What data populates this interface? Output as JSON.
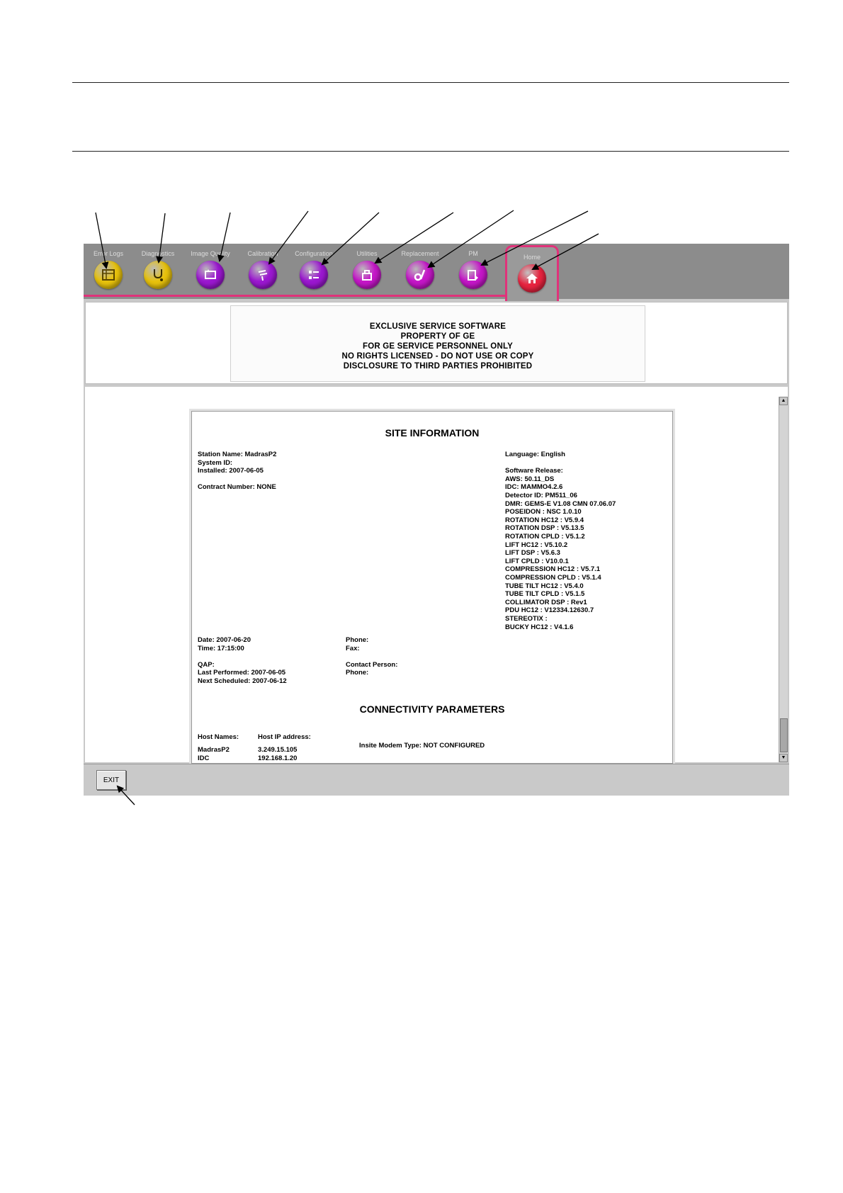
{
  "tabs": [
    {
      "label": "Error Logs",
      "icon": "error-logs-icon",
      "color": "#e8c20c"
    },
    {
      "label": "Diagnostics",
      "icon": "stethoscope-icon",
      "color": "#e8c20c"
    },
    {
      "label": "Image Quality",
      "icon": "image-quality-icon",
      "color": "#9b17d0"
    },
    {
      "label": "Calibration",
      "icon": "calibration-icon",
      "color": "#9b17d0"
    },
    {
      "label": "Configuration",
      "icon": "configuration-icon",
      "color": "#9b17d0"
    },
    {
      "label": "Utilities",
      "icon": "utilities-icon",
      "color": "#c516c8"
    },
    {
      "label": "Replacement",
      "icon": "replacement-icon",
      "color": "#c516c8"
    },
    {
      "label": "PM",
      "icon": "pm-icon",
      "color": "#c516c8"
    }
  ],
  "home_tab": {
    "label": "Home",
    "icon": "home-icon",
    "color": "#e8233f"
  },
  "banner": {
    "lines": [
      "EXCLUSIVE SERVICE SOFTWARE",
      "PROPERTY OF GE",
      "FOR GE SERVICE PERSONNEL ONLY",
      "NO RIGHTS LICENSED - DO NOT USE OR COPY",
      "DISCLOSURE TO THIRD PARTIES PROHIBITED"
    ]
  },
  "report": {
    "title": "SITE INFORMATION",
    "left_block": [
      "Station Name: MadrasP2",
      "System ID:",
      "Installed: 2007-06-05",
      "",
      "Contract Number: NONE"
    ],
    "right_block": [
      "Language: English",
      "",
      "Software Release:",
      "AWS: 50.11_DS",
      "IDC: MAMMO4.2.6",
      "Detector ID: PM511_06",
      "DMR: GEMS-E V1.08 CMN 07.06.07",
      "POSEIDON : NSC 1.0.10",
      "ROTATION HC12 : V5.9.4",
      "ROTATION DSP : V5.13.5",
      "ROTATION CPLD : V5.1.2",
      "LIFT HC12 : V5.10.2",
      "LIFT DSP : V5.6.3",
      "LIFT CPLD : V10.0.1",
      "COMPRESSION HC12 : V5.7.1",
      "COMPRESSION CPLD : V5.1.4",
      "TUBE TILT HC12 : V5.4.0",
      "TUBE TILT CPLD : V5.1.5",
      "COLLIMATOR DSP : Rev1",
      "PDU HC12 : V12334.12630.7",
      "STEREOTIX :",
      "BUCKY HC12 : V4.1.6"
    ],
    "date_block": [
      "Date: 2007-06-20",
      "Time: 17:15:00",
      "",
      "QAP:",
      "Last Performed: 2007-06-05",
      "Next Scheduled: 2007-06-12"
    ],
    "contact_block": [
      "Phone:",
      "Fax:",
      "",
      "Contact Person:",
      "Phone:"
    ],
    "connectivity_title": "CONNECTIVITY PARAMETERS",
    "host_names_header": "Host Names:",
    "host_ip_header": "Host IP address:",
    "hosts": [
      {
        "name": "MadrasP2",
        "ip": "3.249.15.105"
      },
      {
        "name": "IDC",
        "ip": "192.168.1.20"
      }
    ],
    "modem": "Insite Modem Type: NOT CONFIGURED"
  },
  "exit_label": "EXIT",
  "accent_color": "#e0327a"
}
